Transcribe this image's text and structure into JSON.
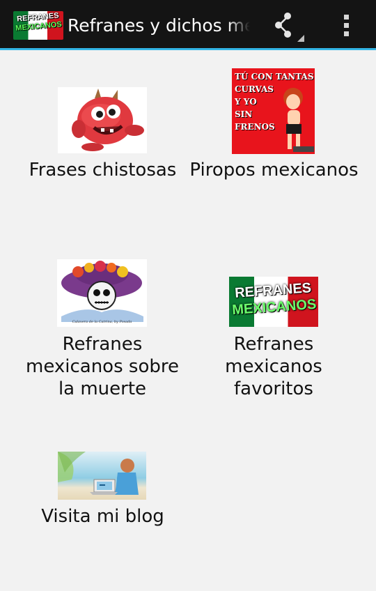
{
  "actionbar": {
    "logo_line1": "REFRANES",
    "logo_line2": "MEXICANOS",
    "title": "Refranes y dichos mexicanos",
    "share_icon": "share-icon",
    "overflow_icon": "overflow-menu-icon",
    "accent_color": "#33b5e5"
  },
  "grid": {
    "items": [
      {
        "label": "Frases chistosas",
        "icon": "red-monster-image"
      },
      {
        "label": "Piropos mexicanos",
        "icon": "piropo-cartoon-image",
        "image_text": [
          "TÚ CON TANTAS",
          "CURVAS",
          "Y YO",
          "SIN",
          "FRENOS"
        ]
      },
      {
        "label": "Refranes mexicanos sobre la muerte",
        "icon": "catrina-skeleton-image",
        "image_caption": "Calavera de la Catrina, by Posada"
      },
      {
        "label": "Refranes mexicanos favoritos",
        "icon": "refranes-mexicanos-banner-image",
        "image_text": [
          "REFRANES",
          "MEXICANOS"
        ]
      },
      {
        "label": "Visita mi blog",
        "icon": "beach-laptop-image"
      }
    ]
  }
}
